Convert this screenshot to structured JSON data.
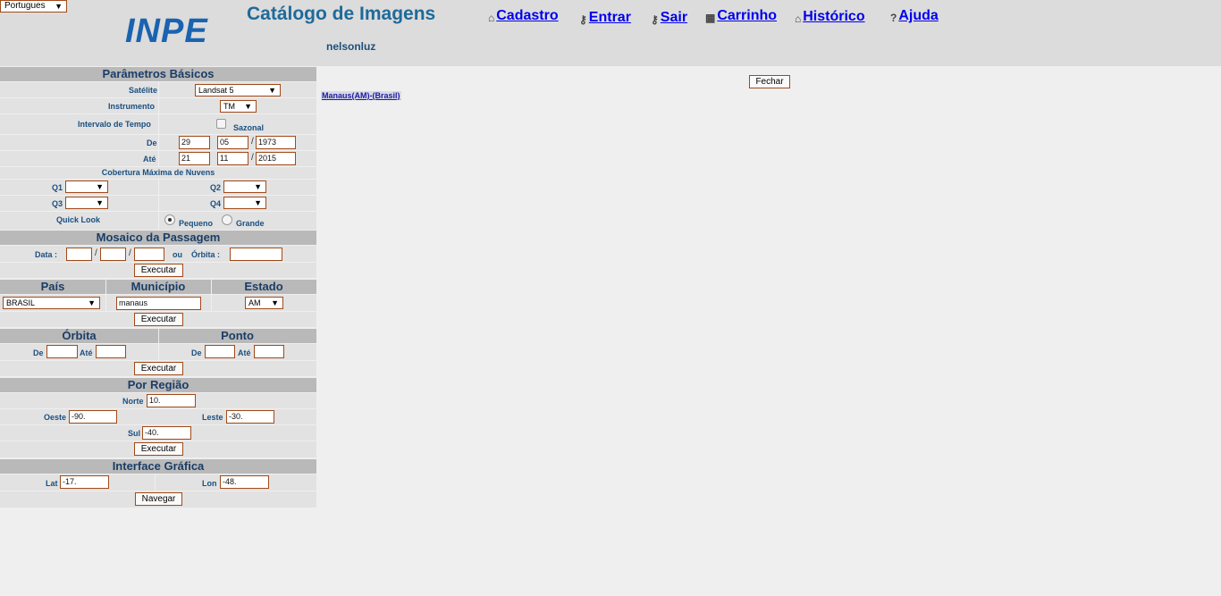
{
  "header": {
    "language": "Portugues",
    "logo": "INPE",
    "title": "Catálogo de Imagens",
    "username": "nelsonluz",
    "nav": [
      {
        "label": "Cadastro",
        "icon": "home-icon"
      },
      {
        "label": "Entrar",
        "icon": "key-icon"
      },
      {
        "label": "Sair",
        "icon": "key-icon"
      },
      {
        "label": "Carrinho",
        "icon": "cart-icon"
      },
      {
        "label": "Histórico",
        "icon": "bag-icon"
      },
      {
        "label": "Ajuda",
        "icon": "help-icon"
      }
    ]
  },
  "basic": {
    "section_title": "Parâmetros Básicos",
    "satellite_label": "Satélite",
    "satellite_value": "Landsat 5",
    "instrument_label": "Instrumento",
    "instrument_value": "TM",
    "interval_label": "Intervalo de Tempo",
    "seasonal_label": "Sazonal",
    "from_label": "De",
    "from_day": "29",
    "from_month": "05",
    "from_year": "1973",
    "to_label": "Até",
    "to_day": "21",
    "to_month": "11",
    "to_year": "2015",
    "cloud_label": "Cobertura Máxima de Nuvens",
    "q1_label": "Q1",
    "q2_label": "Q2",
    "q3_label": "Q3",
    "q4_label": "Q4",
    "quicklook_label": "Quick Look",
    "small_label": "Pequeno",
    "large_label": "Grande"
  },
  "mosaic": {
    "section_title": "Mosaico da Passagem",
    "date_label": "Data :",
    "or_label": "ou",
    "orbit_label": "Órbita :",
    "execute": "Executar"
  },
  "location": {
    "country_header": "País",
    "city_header": "Município",
    "state_header": "Estado",
    "country_value": "BRASIL",
    "city_value": "manaus",
    "state_value": "AM",
    "execute": "Executar"
  },
  "orbitpoint": {
    "orbit_header": "Órbita",
    "point_header": "Ponto",
    "from_label": "De",
    "to_label": "Até",
    "execute": "Executar"
  },
  "region": {
    "section_title": "Por Região",
    "north_label": "Norte",
    "north_value": "10.",
    "west_label": "Oeste",
    "west_value": "-90.",
    "east_label": "Leste",
    "east_value": "-30.",
    "south_label": "Sul",
    "south_value": "-40.",
    "execute": "Executar"
  },
  "graphic": {
    "section_title": "Interface Gráfica",
    "lat_label": "Lat",
    "lat_value": "-17.",
    "lon_label": "Lon",
    "lon_value": "-48.",
    "navigate": "Navegar"
  },
  "results": {
    "close": "Fechar",
    "location_link": "Manaus(AM)-(Brasil)"
  }
}
